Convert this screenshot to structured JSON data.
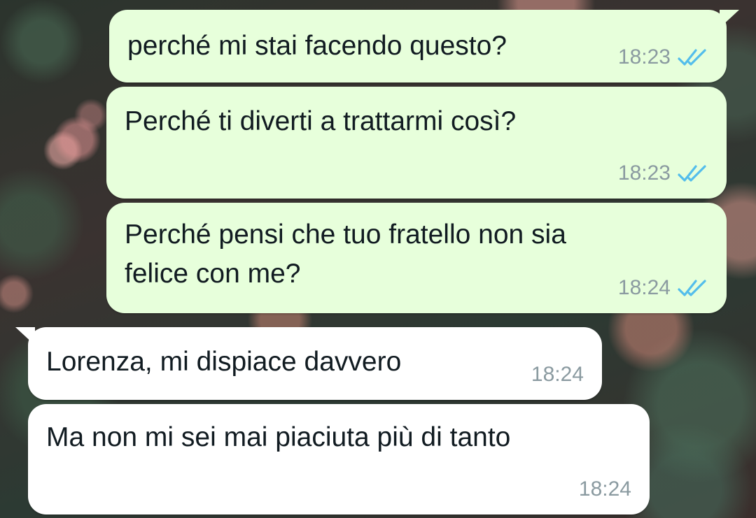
{
  "messages": [
    {
      "direction": "sent",
      "text": "perché mi stai facendo questo?",
      "time": "18:23",
      "status": "read-double-check-icon"
    },
    {
      "direction": "sent",
      "text": "Perché ti diverti a trattarmi così?",
      "time": "18:23",
      "status": "read-double-check-icon"
    },
    {
      "direction": "sent",
      "text_line1": "Perché pensi che tuo fratello non sia",
      "text_line2": "felice con me?",
      "time": "18:24",
      "status": "read-double-check-icon"
    },
    {
      "direction": "received",
      "text": "Lorenza, mi dispiace davvero",
      "time": "18:24"
    },
    {
      "direction": "received",
      "text": "Ma non mi sei mai piaciuta più di tanto",
      "time": "18:24"
    }
  ],
  "colors": {
    "sent_bubble": "#e7ffdb",
    "received_bubble": "#ffffff",
    "read_ticks": "#53bdeb",
    "timestamp": "#8a9aa0",
    "text": "#111b21"
  }
}
